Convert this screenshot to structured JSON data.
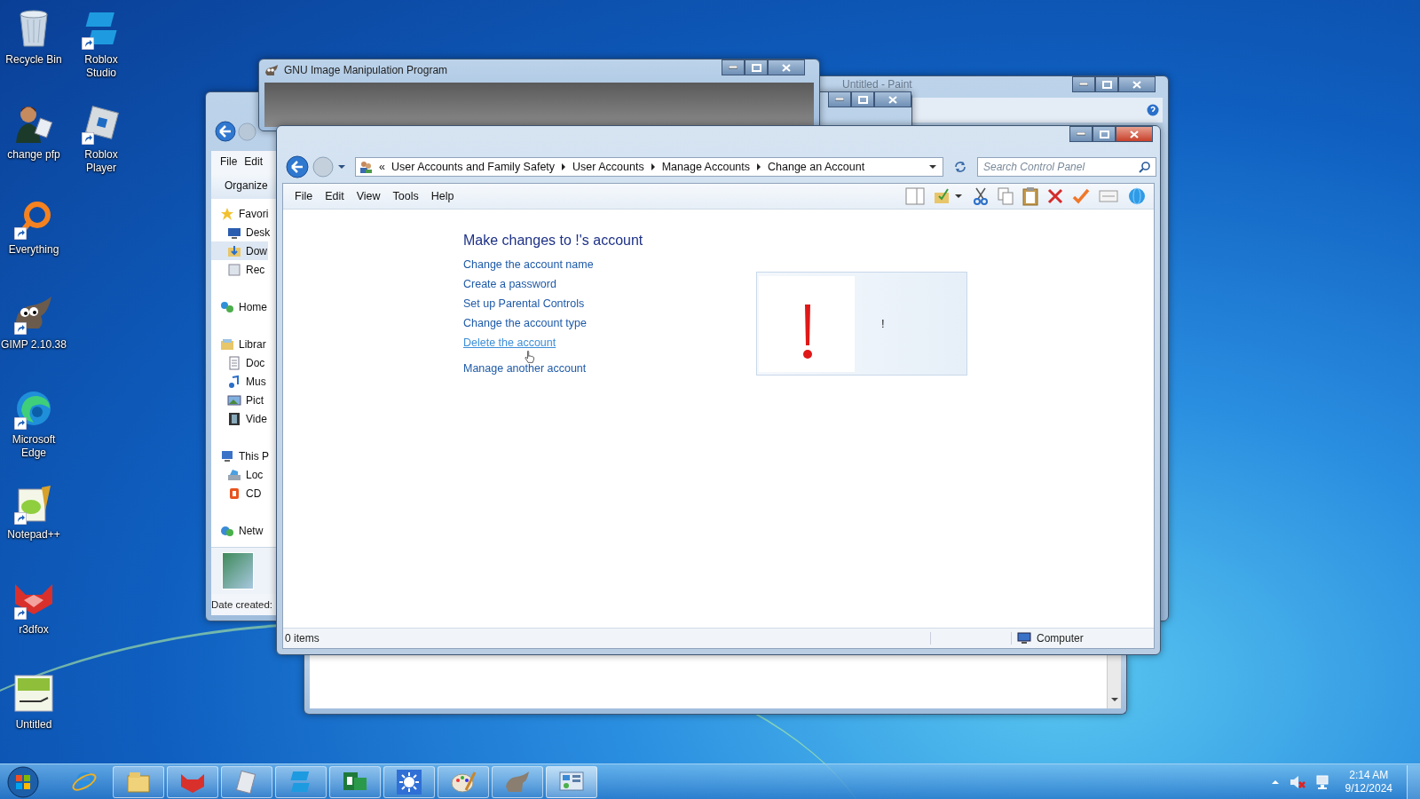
{
  "desktop_icons": [
    {
      "label": "Recycle Bin",
      "kind": "recycle-bin",
      "shortcut": false
    },
    {
      "label": "change pfp",
      "kind": "person",
      "shortcut": false
    },
    {
      "label": "Everything",
      "kind": "magnifier",
      "shortcut": true
    },
    {
      "label": "GIMP 2.10.38",
      "kind": "gimp",
      "shortcut": true
    },
    {
      "label": "Microsoft Edge",
      "kind": "edge",
      "shortcut": true
    },
    {
      "label": "Notepad++",
      "kind": "notepad",
      "shortcut": true
    },
    {
      "label": "r3dfox",
      "kind": "fox",
      "shortcut": true
    },
    {
      "label": "Untitled",
      "kind": "picture",
      "shortcut": false
    },
    {
      "label": "Roblox Studio",
      "kind": "studio",
      "shortcut": true
    },
    {
      "label": "Roblox Player",
      "kind": "player",
      "shortcut": true
    }
  ],
  "paint_window": {
    "title": "Untitled - Paint"
  },
  "gimp_window": {
    "title": "GNU Image Manipulation Program"
  },
  "explorer_window": {
    "menu": [
      "File",
      "Edit"
    ],
    "toolbar": [
      "Organize"
    ],
    "nav": [
      {
        "label": "Favori",
        "kind": "star",
        "selected": false,
        "children": [
          {
            "label": "Desk",
            "kind": "desktop",
            "selected": false
          },
          {
            "label": "Dow",
            "kind": "downloads",
            "selected": true
          },
          {
            "label": "Rec",
            "kind": "recent",
            "selected": false
          }
        ]
      },
      {
        "label": "Home",
        "kind": "homegroup",
        "selected": false
      },
      {
        "label": "Librar",
        "kind": "library",
        "selected": false,
        "children": [
          {
            "label": "Doc",
            "kind": "document",
            "selected": false
          },
          {
            "label": "Mus",
            "kind": "music",
            "selected": false
          },
          {
            "label": "Pict",
            "kind": "pictures",
            "selected": false
          },
          {
            "label": "Vide",
            "kind": "videos",
            "selected": false
          }
        ]
      },
      {
        "label": "This P",
        "kind": "computer",
        "selected": false,
        "children": [
          {
            "label": "Loc",
            "kind": "drive",
            "selected": false
          },
          {
            "label": "CD",
            "kind": "cd",
            "selected": false
          }
        ]
      },
      {
        "label": "Netw",
        "kind": "network",
        "selected": false
      }
    ],
    "details": "Date created:"
  },
  "control_panel": {
    "overflow_mark": "«",
    "breadcrumb": [
      "User Accounts and Family Safety",
      "User Accounts",
      "Manage Accounts",
      "Change an Account"
    ],
    "search": {
      "placeholder": "Search Control Panel"
    },
    "menu": [
      "File",
      "Edit",
      "View",
      "Tools",
      "Help"
    ],
    "heading": "Make changes to !'s account",
    "links": [
      {
        "label": "Change the account name",
        "hovered": false
      },
      {
        "label": "Create a password",
        "hovered": false
      },
      {
        "label": "Set up Parental Controls",
        "hovered": false
      },
      {
        "label": "Change the account type",
        "hovered": false
      },
      {
        "label": "Delete the account",
        "hovered": true
      },
      {
        "label": "Manage another account",
        "hovered": false
      }
    ],
    "account": {
      "name": "!"
    },
    "status_bar": {
      "items": "0 items",
      "location": "Computer"
    }
  },
  "taskbar": {
    "buttons": [
      {
        "kind": "ie",
        "running": false,
        "selected": false
      },
      {
        "kind": "explorer",
        "running": true,
        "selected": false
      },
      {
        "kind": "fox",
        "running": true,
        "selected": false
      },
      {
        "kind": "notes",
        "running": true,
        "selected": false
      },
      {
        "kind": "studio",
        "running": true,
        "selected": false
      },
      {
        "kind": "project",
        "running": true,
        "selected": false
      },
      {
        "kind": "sun",
        "running": true,
        "selected": false
      },
      {
        "kind": "paint",
        "running": true,
        "selected": false
      },
      {
        "kind": "gimp",
        "running": true,
        "selected": false
      },
      {
        "kind": "control",
        "running": true,
        "selected": true
      }
    ],
    "volume_muted": true,
    "clock": {
      "time": "2:14 AM",
      "date": "9/12/2024"
    }
  }
}
